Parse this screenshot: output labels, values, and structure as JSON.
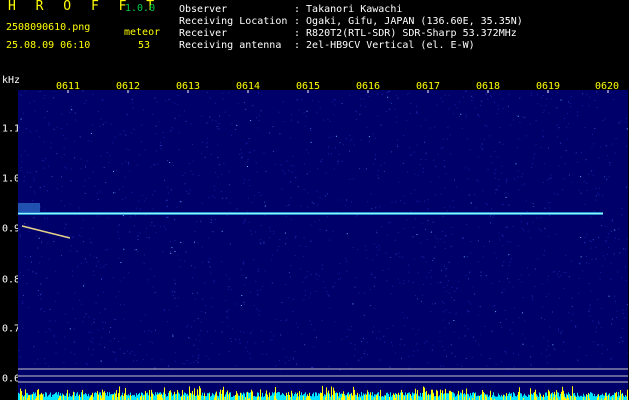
{
  "app": {
    "name": "H R O F F T",
    "version": "1.0.0"
  },
  "file": {
    "name": "2508090610.png",
    "timestamp": "25.08.09 06:10"
  },
  "meteor": {
    "label": "meteor",
    "count": "53"
  },
  "info": [
    {
      "key": "Observer",
      "value": ": Takanori Kawachi"
    },
    {
      "key": "Receiving Location",
      "value": ": Ogaki, Gifu, JAPAN (136.60E, 35.35N)"
    },
    {
      "key": "Receiver",
      "value": ": R820T2(RTL-SDR) SDR-Sharp 53.372MHz"
    },
    {
      "key": "Receiving antenna",
      "value": ": 2el-HB9CV Vertical (el. E-W)"
    }
  ],
  "axis": {
    "unit": "kHz",
    "x_ticks": [
      "0611",
      "0612",
      "0613",
      "0614",
      "0615",
      "0616",
      "0617",
      "0618",
      "0619",
      "0620"
    ],
    "y_ticks": [
      "1.1",
      "1.0",
      "0.9",
      "0.8",
      "0.7",
      "0.6"
    ]
  },
  "colors": {
    "plot_bg": "#00006a",
    "echo_line": "#33e0ff",
    "noise_cyan": "#00e5ff",
    "noise_yellow": "#ffff00"
  }
}
